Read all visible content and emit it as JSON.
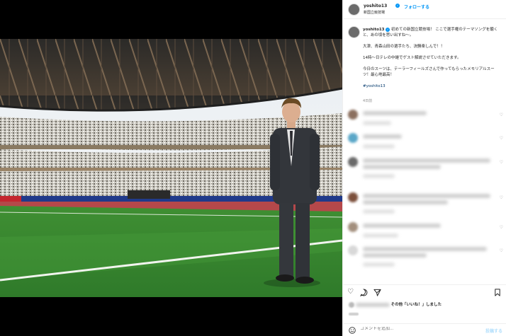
{
  "header": {
    "username": "yoshito13",
    "follow_label": "フォローする",
    "location": "新国立競技場"
  },
  "caption": {
    "username": "yoshito13",
    "paragraphs": [
      "初めての新国立競技場！ ここで選手権のテーマソングを聴くと、あの頃を思い出すね〜。",
      "大津、青森山田の選手たち、決勝楽しんで！！",
      "14時〜日テレの中継でゲスト解説させていただきます。",
      "今日のスーツは、テーラーフィールズさんで作ってもらったメモリアルスーツ！最心地最高！"
    ],
    "hashtag": "#yoshito13",
    "time": "4日前"
  },
  "likes": {
    "by_suffix": "その他「いいね！」しました"
  },
  "comment_box": {
    "placeholder": "コメントを追加..."
  },
  "icons": {
    "like": "heart-icon",
    "comment": "comment-icon",
    "share": "paper-plane-icon",
    "save": "bookmark-icon",
    "emoji": "smiley-icon",
    "more": "ellipsis-icon"
  },
  "colors": {
    "accent": "#0095f6",
    "text": "#262626",
    "muted": "#8e8e8e"
  }
}
